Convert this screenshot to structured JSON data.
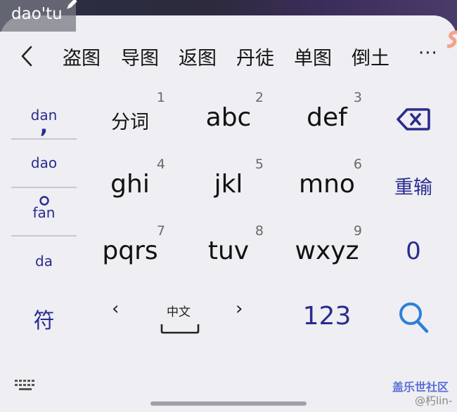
{
  "composition": {
    "text": "dao'tu"
  },
  "candidates": [
    "盗图",
    "导图",
    "返图",
    "丹徒",
    "单图",
    "倒土"
  ],
  "more_label": "···",
  "pinyin_options": [
    "dan",
    "dao",
    "fan",
    "da"
  ],
  "keys": [
    {
      "label": "分词",
      "num": "1"
    },
    {
      "label": "abc",
      "num": "2"
    },
    {
      "label": "def",
      "num": "3"
    },
    {
      "label": "ghi",
      "num": "4"
    },
    {
      "label": "jkl",
      "num": "5"
    },
    {
      "label": "mno",
      "num": "6"
    },
    {
      "label": "pqrs",
      "num": "7"
    },
    {
      "label": "tuv",
      "num": "8"
    },
    {
      "label": "wxyz",
      "num": "9"
    }
  ],
  "function_keys": {
    "reinput": "重输",
    "zero": "0"
  },
  "bottom_row": {
    "symbol": "符",
    "space_label": "中文",
    "left_arrow": "‹",
    "right_arrow": "›",
    "numbers": "123"
  },
  "watermark": {
    "line1": "盖乐世社区",
    "line2": "@朽lin-"
  },
  "colors": {
    "accent": "#2a2b8f",
    "search": "#2f7fd6",
    "background": "#eeeef3"
  }
}
